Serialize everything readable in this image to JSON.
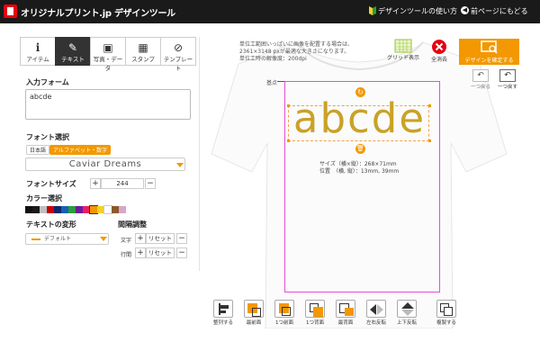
{
  "header": {
    "brand": "オリジナルプリント.jp デザインツール",
    "howto": "デザインツールの使い方",
    "back": "前ページにもどる"
  },
  "tabs": [
    {
      "label": "アイテム",
      "icon": "info-icon"
    },
    {
      "label": "テキスト",
      "icon": "pen-icon"
    },
    {
      "label": "写真・データ",
      "icon": "image-icon"
    },
    {
      "label": "スタンプ",
      "icon": "stamp-icon"
    },
    {
      "label": "テンプレート",
      "icon": "compass-icon"
    }
  ],
  "text_panel": {
    "input_label": "入力フォーム",
    "input_value": "abcde",
    "font_label": "フォント選択",
    "font_tab_ja": "日本語",
    "font_tab_en": "アルファベット・数字",
    "font_value": "Caviar Dreams",
    "size_label": "フォントサイズ",
    "size_value": "244",
    "color_label": "カラー選択",
    "transform_label": "テキストの変形",
    "transform_value": "デフォルト",
    "spacing_label": "間隔調整",
    "char_label": "文字",
    "line_label": "行間",
    "reset_label": "リセット"
  },
  "swatch_colors": [
    "#111111",
    "#1a1a1a",
    "#c0c0c0",
    "#cc0000",
    "#0a2a6e",
    "#1a5fb4",
    "#2a9d3a",
    "#6a1b9a",
    "#e91e63",
    "#f39800",
    "#f2d024",
    "#ffffff",
    "#8b5a2b",
    "#d9a6c9"
  ],
  "canvas": {
    "note": "単位工範囲いっぱいに画像を配置する場合は、\n2361×3148 pxが最適な大きさになります。\n単位工時の解像度：200dpi",
    "kiten": "基点",
    "design_text": "abcde",
    "info": "サイズ（横×縦）：268×71mm\n位置　（横, 縦）：13mm, 39mm"
  },
  "toolbar": {
    "grid": "グリッド表示",
    "delete_all": "全消去",
    "confirm": "デザインを確定する",
    "undo": "一つ戻る",
    "redo": "一つ戻す"
  },
  "bottom_tools": [
    {
      "label": "整列する"
    },
    {
      "label": "最前面"
    },
    {
      "label": "1つ前面"
    },
    {
      "label": "1つ背面"
    },
    {
      "label": "最背面"
    },
    {
      "label": "左右反転"
    },
    {
      "label": "上下反転"
    },
    {
      "label": "複製する"
    }
  ],
  "colors": {
    "accent": "#f39800",
    "text_gold": "#c9a227",
    "design_area": "#e44fd0",
    "delete": "#e60012"
  }
}
